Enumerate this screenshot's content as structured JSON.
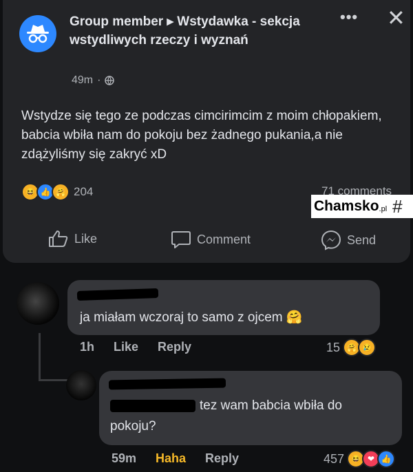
{
  "post": {
    "header_text": "Group member ▸ Wstydawka - sekcja wstydliwych rzeczy i wyznań",
    "time": "49m",
    "body": "Wstydze się tego ze podczas cimcirimcim z moim chłopakiem, babcia wbiła nam do pokoju bez żadnego pukania,a nie zdążyliśmy się zakryć xD",
    "reaction_count": "204",
    "comments_count": "71 comments",
    "actions": {
      "like": "Like",
      "comment": "Comment",
      "send": "Send"
    },
    "icons": [
      "incognito-icon",
      "globe-icon",
      "more-icon",
      "close-icon",
      "haha-icon",
      "like-icon",
      "care-icon",
      "like-outline-icon",
      "comment-outline-icon",
      "messenger-icon"
    ]
  },
  "watermark": {
    "main": "Chamsko",
    "suffix": ".pl",
    "hash": "#"
  },
  "comment1": {
    "text": "ja miałam wczoraj to samo z ojcem",
    "time": "1h",
    "like": "Like",
    "reply": "Reply",
    "reaction_count": "15"
  },
  "comment2": {
    "text_line1": "tez wam babcia wbiła do",
    "text_line2": "pokoju?",
    "time": "59m",
    "reaction_label": "Haha",
    "reply": "Reply",
    "reaction_count": "457"
  },
  "colors": {
    "accent": "#2d88ff",
    "haha_yellow": "#f7b125",
    "highlight": "#f7b928",
    "bg": "#0f1012",
    "card": "#232427",
    "bubble": "#35363a"
  }
}
